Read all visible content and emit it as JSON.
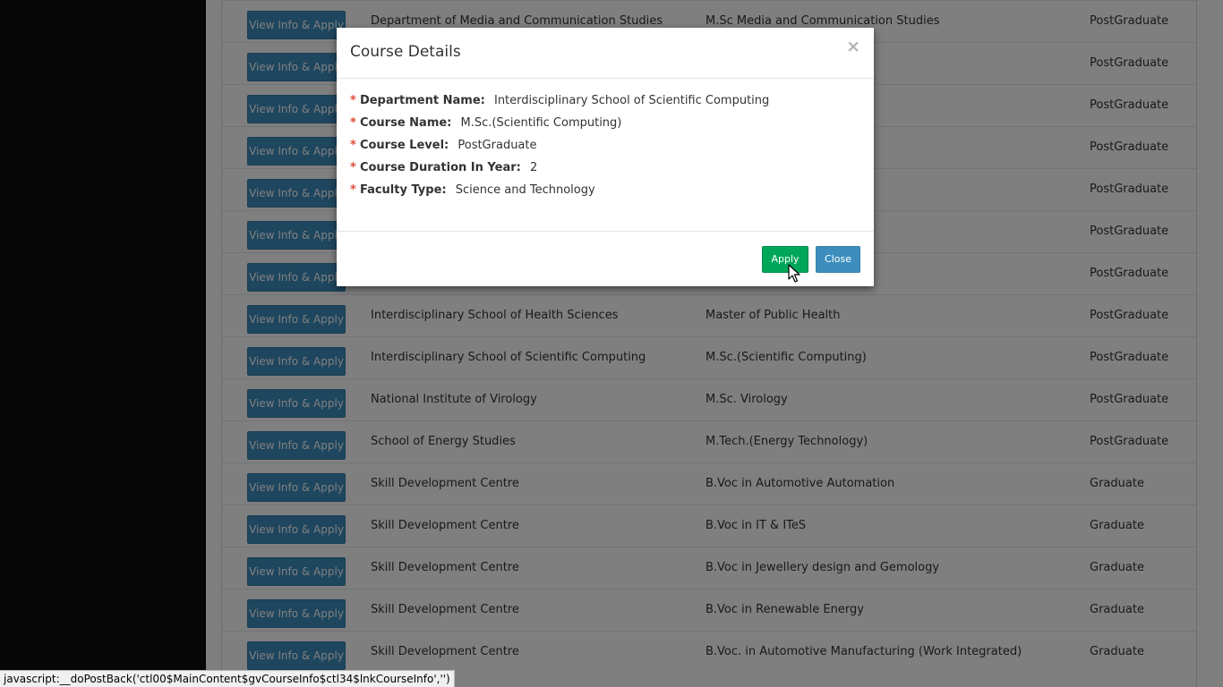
{
  "table": {
    "rows": [
      {
        "button": "View Info & Apply",
        "department": "Department of Media and Communication Studies",
        "course": "M.Sc Media and Communication Studies",
        "level": "PostGraduate"
      },
      {
        "button": "View Info & Apply",
        "department": "",
        "course": "",
        "level": "PostGraduate"
      },
      {
        "button": "View Info & Apply",
        "department": "",
        "course": "",
        "level": "PostGraduate"
      },
      {
        "button": "View Info & Apply",
        "department": "",
        "course": "",
        "level": "PostGraduate"
      },
      {
        "button": "View Info & Apply",
        "department": "",
        "course": "",
        "level": "PostGraduate"
      },
      {
        "button": "View Info & Apply",
        "department": "",
        "course": "",
        "level": "PostGraduate"
      },
      {
        "button": "View Info & Apply",
        "department": "",
        "course": "",
        "level": "PostGraduate"
      },
      {
        "button": "View Info & Apply",
        "department": "Interdisciplinary School of Health Sciences",
        "course": "Master of Public Health",
        "level": "PostGraduate"
      },
      {
        "button": "View Info & Apply",
        "department": "Interdisciplinary School of Scientific Computing",
        "course": "M.Sc.(Scientific Computing)",
        "level": "PostGraduate"
      },
      {
        "button": "View Info & Apply",
        "department": "National Institute of Virology",
        "course": "M.Sc. Virology",
        "level": "PostGraduate"
      },
      {
        "button": "View Info & Apply",
        "department": "School of Energy Studies",
        "course": "M.Tech.(Energy Technology)",
        "level": "PostGraduate"
      },
      {
        "button": "View Info & Apply",
        "department": "Skill Development Centre",
        "course": "B.Voc in Automotive Automation",
        "level": "Graduate"
      },
      {
        "button": "View Info & Apply",
        "department": "Skill Development Centre",
        "course": "B.Voc in IT & ITeS",
        "level": "Graduate"
      },
      {
        "button": "View Info & Apply",
        "department": "Skill Development Centre",
        "course": "B.Voc in Jewellery design and Gemology",
        "level": "Graduate"
      },
      {
        "button": "View Info & Apply",
        "department": "Skill Development Centre",
        "course": "B.Voc in Renewable Energy",
        "level": "Graduate"
      },
      {
        "button": "View Info & Apply",
        "department": "Skill Development Centre",
        "course": "B.Voc. in Automotive Manufacturing (Work Integrated)",
        "level": "Graduate"
      }
    ]
  },
  "modal": {
    "title": "Course Details",
    "close_glyph": "×",
    "required_mark": "*",
    "details": [
      {
        "label": "Department Name:",
        "value": "Interdisciplinary School of Scientific Computing"
      },
      {
        "label": "Course Name:",
        "value": "M.Sc.(Scientific Computing)"
      },
      {
        "label": "Course Level:",
        "value": "PostGraduate"
      },
      {
        "label": "Course Duration In Year:",
        "value": "2"
      },
      {
        "label": "Faculty Type:",
        "value": "Science and Technology"
      }
    ],
    "apply_label": "Apply",
    "close_label": "Close"
  },
  "status_bar": {
    "text": "javascript:__doPostBack('ctl00$MainContent$gvCourseInfo$ctl34$lnkCourseInfo','')"
  },
  "colors": {
    "primary": "#3c8dbc",
    "success": "#00a65a",
    "required": "#dd4b39"
  },
  "icons": {
    "cursor": "mouse-pointer-icon"
  }
}
